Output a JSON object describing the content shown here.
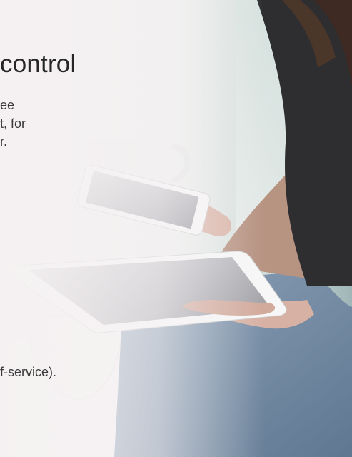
{
  "heading": "control",
  "body_lines": [
    "ee",
    "t, for",
    "r.",
    "f-service)."
  ]
}
